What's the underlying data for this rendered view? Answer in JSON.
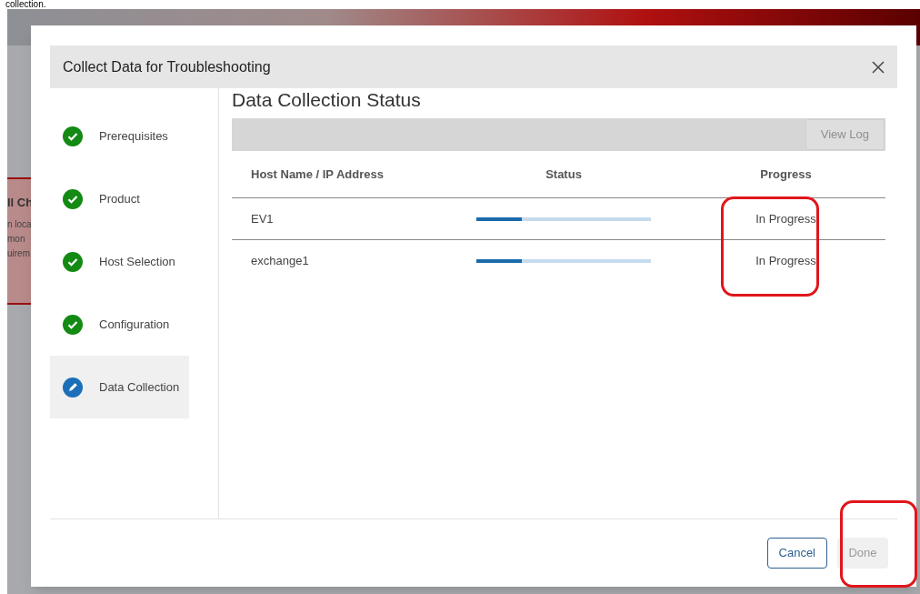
{
  "caption": "collection.",
  "background_card": {
    "lines": [
      "ll Ch",
      "n loca",
      "mon",
      "uirem"
    ]
  },
  "dialog": {
    "title": "Collect Data for Troubleshooting",
    "steps": [
      {
        "label": "Prerequisites",
        "kind": "complete",
        "selected": false
      },
      {
        "label": "Product",
        "kind": "complete",
        "selected": false
      },
      {
        "label": "Host Selection",
        "kind": "complete",
        "selected": false
      },
      {
        "label": "Configuration",
        "kind": "complete",
        "selected": false
      },
      {
        "label": "Data Collection",
        "kind": "current",
        "selected": true
      }
    ],
    "heading": "Data Collection Status",
    "view_log_button": {
      "label": "View Log",
      "disabled": true
    },
    "table": {
      "columns": [
        "Host Name / IP Address",
        "Status",
        "Progress"
      ],
      "rows": [
        {
          "host": "EV1",
          "level": 0.26,
          "progress": "In Progress"
        },
        {
          "host": "exchange1",
          "level": 0.26,
          "progress": "In Progress"
        }
      ]
    },
    "buttons": [
      {
        "label": "Cancel",
        "disabled": false
      },
      {
        "label": "Done",
        "disabled": true
      }
    ]
  }
}
